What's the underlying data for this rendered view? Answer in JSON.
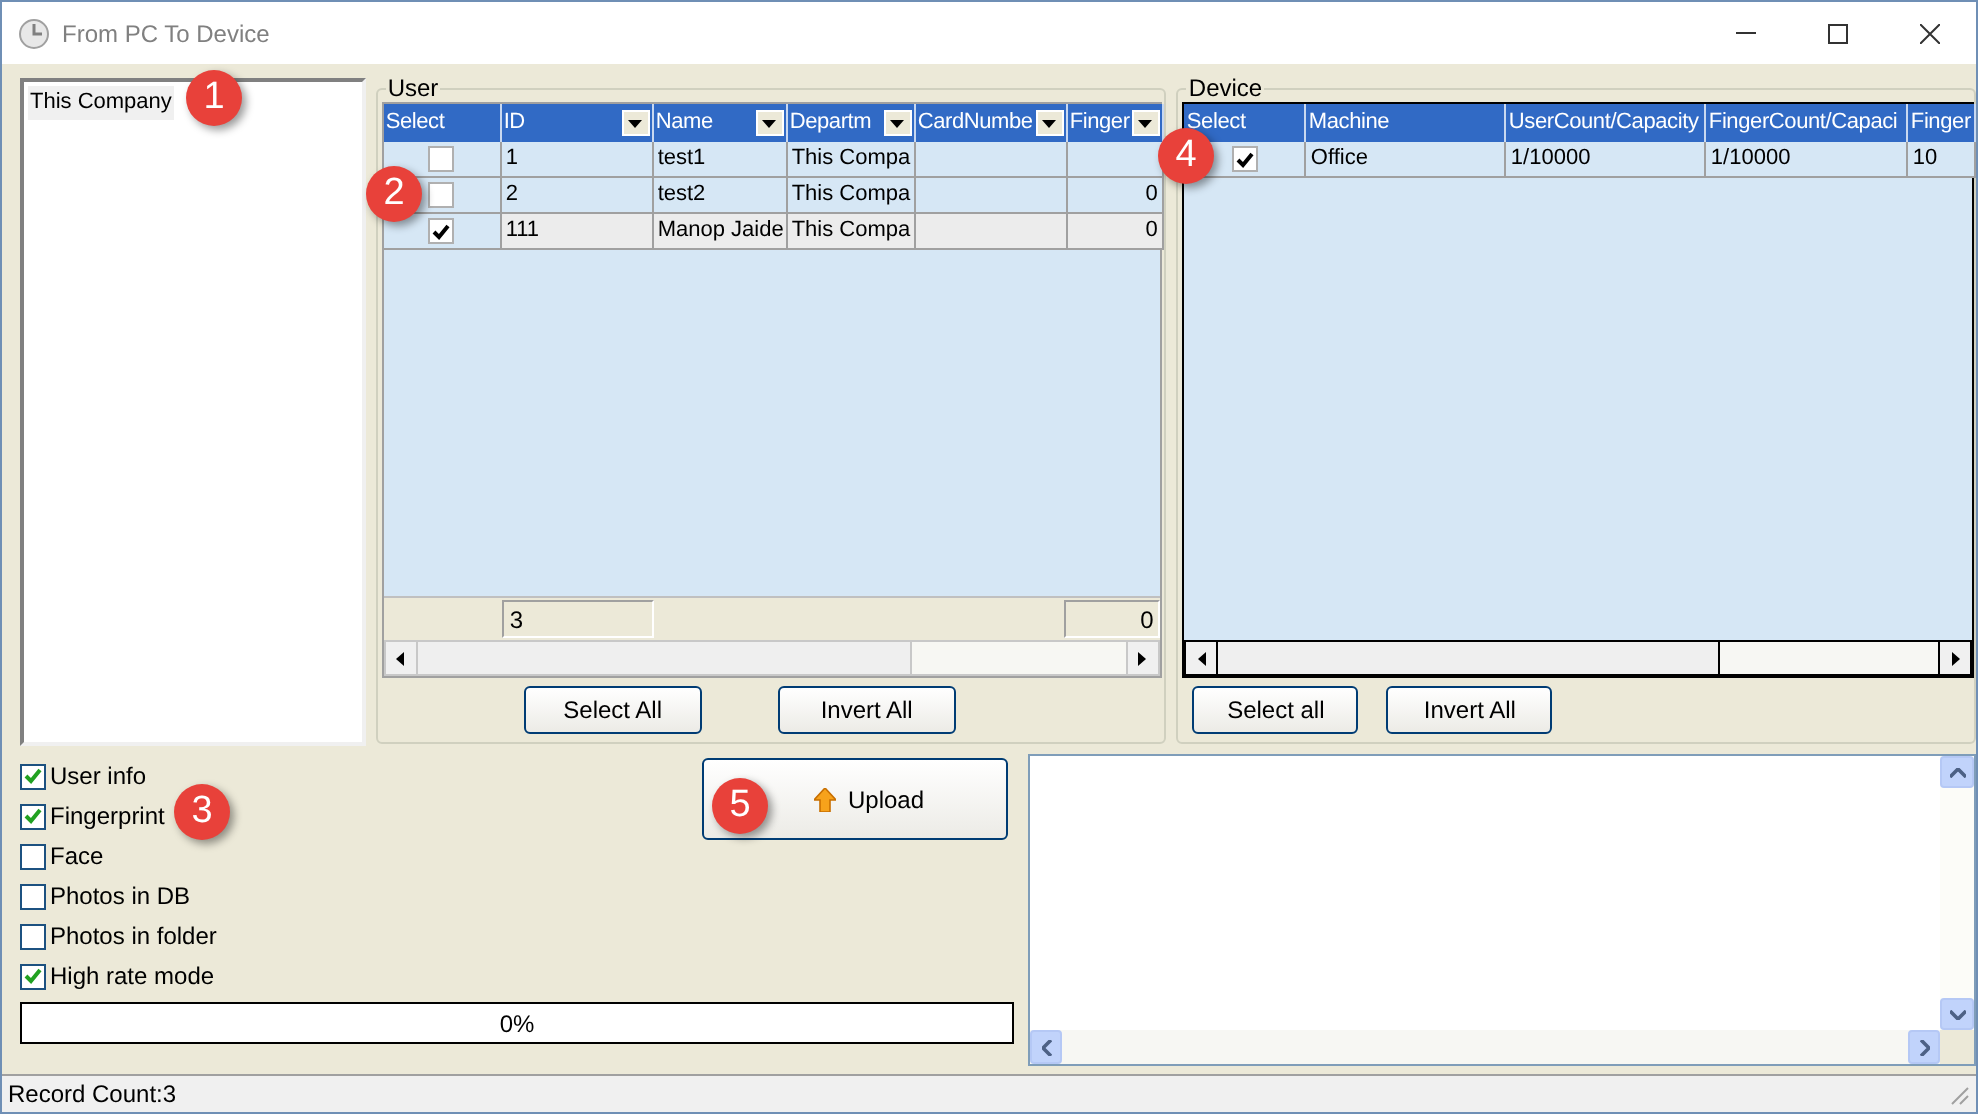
{
  "window": {
    "title": "From PC To Device"
  },
  "department_tree": {
    "items": [
      {
        "label": "This Company",
        "selected": true
      }
    ]
  },
  "user_group": {
    "title": "User",
    "columns": [
      {
        "label": "Select",
        "has_filter": false
      },
      {
        "label": "ID",
        "has_filter": true
      },
      {
        "label": "Name",
        "has_filter": true
      },
      {
        "label": "Departm",
        "has_filter": true
      },
      {
        "label": "CardNumbe",
        "has_filter": true
      },
      {
        "label": "Finger",
        "has_filter": true
      }
    ],
    "rows": [
      {
        "checked": false,
        "selected": false,
        "cells": [
          "",
          "1",
          "test1",
          "This Compa",
          "",
          ""
        ]
      },
      {
        "checked": false,
        "selected": false,
        "cells": [
          "",
          "2",
          "test2",
          "This Compa",
          "",
          "0"
        ]
      },
      {
        "checked": true,
        "selected": true,
        "cells": [
          "",
          "111",
          "Manop Jaide",
          "This Compa",
          "",
          "0"
        ]
      }
    ],
    "footer": [
      "3",
      "0"
    ],
    "buttons": [
      "Select All",
      "Invert All"
    ]
  },
  "device_group": {
    "title": "Device",
    "columns": [
      {
        "label": "Select"
      },
      {
        "label": "Machine"
      },
      {
        "label": "UserCount/Capacity"
      },
      {
        "label": "FingerCount/Capaci"
      },
      {
        "label": "Finger"
      }
    ],
    "rows": [
      {
        "checked": true,
        "cells": [
          "",
          "Office",
          "1/10000",
          "1/10000",
          "10"
        ]
      }
    ],
    "buttons": [
      "Select all",
      "Invert All"
    ]
  },
  "options": [
    {
      "label": "User info",
      "checked": true
    },
    {
      "label": "Fingerprint",
      "checked": true
    },
    {
      "label": "Face",
      "checked": false
    },
    {
      "label": "Photos in DB",
      "checked": false
    },
    {
      "label": "Photos in folder",
      "checked": false
    },
    {
      "label": "High rate mode",
      "checked": true
    }
  ],
  "upload_button": {
    "label": "Upload"
  },
  "progress": {
    "level": 0,
    "text": "0%"
  },
  "status_bar": {
    "text": "Record Count:3"
  },
  "callouts": [
    "1",
    "2",
    "3",
    "4",
    "5"
  ]
}
